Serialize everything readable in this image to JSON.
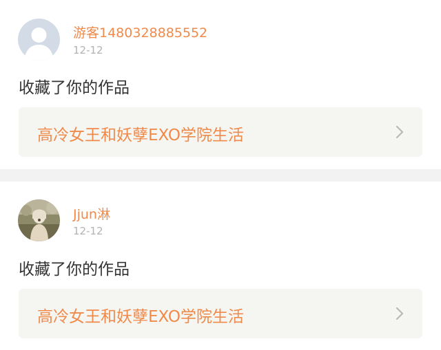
{
  "colors": {
    "accent": "#f08a4b",
    "muted": "#b3b3b3",
    "text": "#333333",
    "link_bg": "#f5f5f1",
    "separator": "#f2f2f2"
  },
  "notifications": [
    {
      "avatar_icon": "default-user-avatar",
      "username": "游客1480328885552",
      "timestamp": "12-12",
      "action": "收藏了你的作品",
      "work_title": "高冷女王和妖孽EXO学院生活",
      "chevron_icon": "chevron-right-icon"
    },
    {
      "avatar_icon": "user-photo-avatar",
      "username": "Jjun淋",
      "timestamp": "12-12",
      "action": "收藏了你的作品",
      "work_title": "高冷女王和妖孽EXO学院生活",
      "chevron_icon": "chevron-right-icon"
    }
  ]
}
